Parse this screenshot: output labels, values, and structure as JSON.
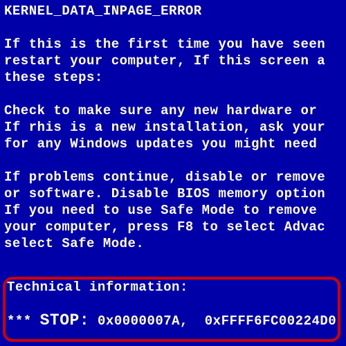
{
  "error_title": "KERNEL_DATA_INPAGE_ERROR",
  "para1": {
    "l1": "If this is the first time you have seen",
    "l2": "restart your computer, If this screen a",
    "l3": "these steps:"
  },
  "para2": {
    "l1": "Check to make sure any new hardware or ",
    "l2": "If rhis is a new installation, ask your",
    "l3": "for any Windows updates you might need "
  },
  "para3": {
    "l1": "If problems continue, disable or remove",
    "l2": "or software. Disable BIOS memory option",
    "l3": "If you need to use Safe Mode to remove ",
    "l4": "your computer, press F8 to select Advac",
    "l5": "select Safe Mode."
  },
  "tech": {
    "heading": "Technical information:",
    "stars": "*** ",
    "stop_label": "STOP:",
    "code1": " 0x0000007A,",
    "code2": "0xFFFF6FC00224D0"
  }
}
